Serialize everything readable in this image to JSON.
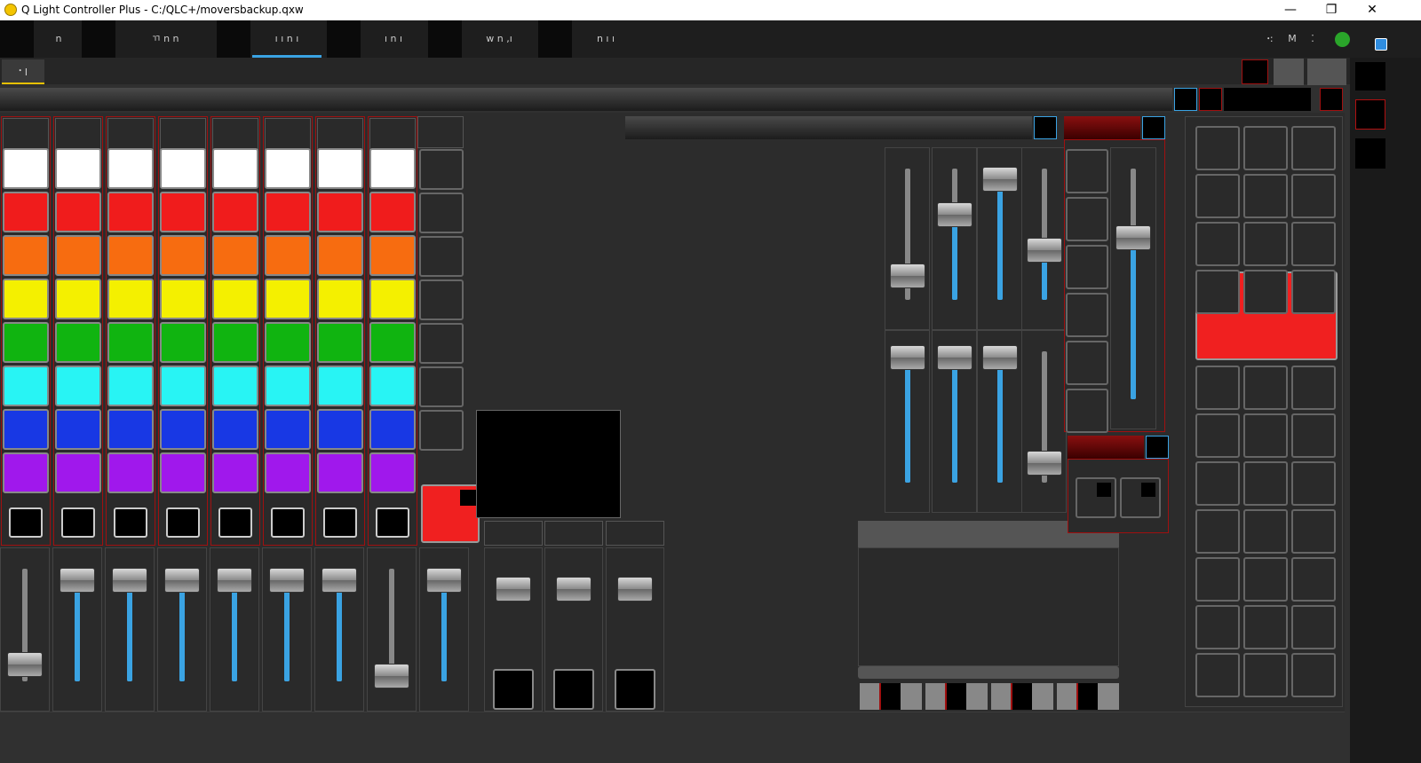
{
  "window": {
    "title": "Q Light Controller Plus - C:/QLC+/moversbackup.qxw",
    "minimize": "—",
    "restore": "❐",
    "close": "✕"
  },
  "toolbar": {
    "tabs": [
      {
        "label": "n"
      },
      {
        "label": "ㄲ   n  n"
      },
      {
        "label": "ı ı  n  ı"
      },
      {
        "label": "ı n ı"
      },
      {
        "label": "w  n  ,ı"
      },
      {
        "label": "n  ı  ı"
      }
    ],
    "right_items": [
      "ꞏ:",
      "M",
      "⁚"
    ],
    "status_color": "#2aa52a"
  },
  "subbar": {
    "tab_label": "ꞏ ꞁ"
  },
  "colors": {
    "accent": "#3aa3e3",
    "selection": "#b01010"
  }
}
